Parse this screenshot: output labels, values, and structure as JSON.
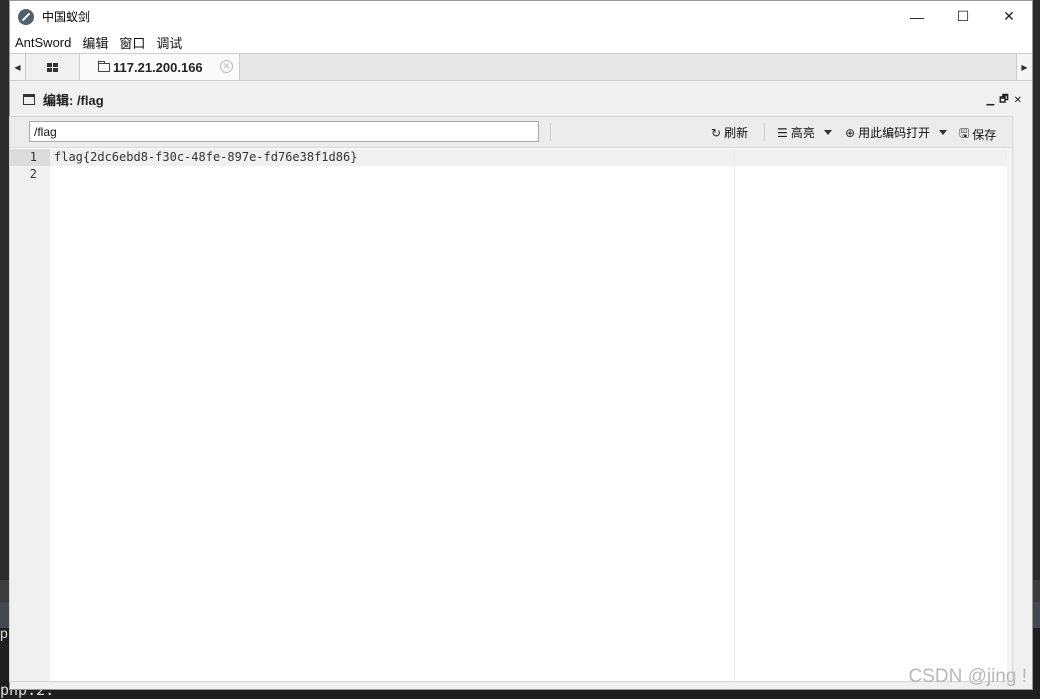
{
  "window": {
    "title": "中国蚁剑",
    "controls": {
      "minimize": "—",
      "maximize": "☐",
      "close": "✕"
    }
  },
  "menu": [
    {
      "label": "AntSword"
    },
    {
      "label": "编辑"
    },
    {
      "label": "窗口"
    },
    {
      "label": "调试"
    }
  ],
  "tabs": {
    "active_label": "117.21.200.166",
    "close_glyph": "✕",
    "left_arrow": "◀",
    "right_arrow": "▶"
  },
  "panel": {
    "title": "编辑: /flag",
    "controls": {
      "minimize": "▁",
      "restore": "🗗",
      "close": "✕"
    }
  },
  "toolbar": {
    "path_value": "/flag",
    "refresh_label": "刷新",
    "highlight_label": "高亮",
    "open_with_encoding_label": "用此编码打开",
    "save_label": "保存"
  },
  "editor": {
    "line_numbers": [
      "1",
      "2"
    ],
    "lines": [
      "flag{2dc6ebd8-f30c-48fe-897e-fd76e38f1d86}",
      ""
    ]
  },
  "background": {
    "terminal_text": "php.2.",
    "terminal_left_char": "p"
  },
  "watermark": "CSDN @jing !"
}
